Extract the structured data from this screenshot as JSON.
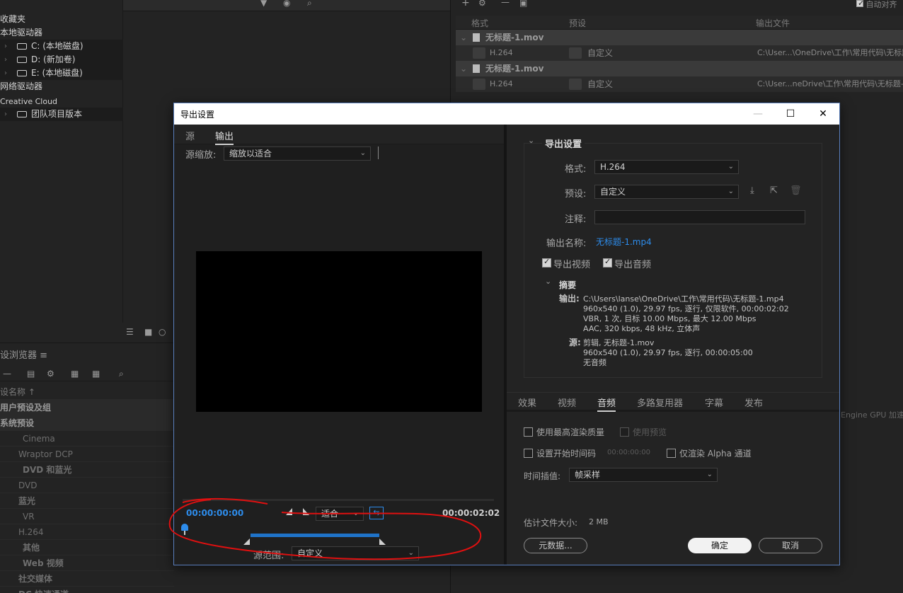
{
  "background_app": {
    "tree": {
      "favorites": "收藏夹",
      "local_drives": "本地驱动器",
      "drive_c": "C: (本地磁盘)",
      "drive_d": "D: (新加卷)",
      "drive_e": "E: (本地磁盘)",
      "network_drives": "网络驱动器",
      "creative_cloud": "Creative Cloud",
      "team_project": "团队项目版本"
    },
    "preset_browser": {
      "title": "设浏览器",
      "column_preset_name": "设名称",
      "user_presets": "用户预设及组",
      "system_presets": "系统预设",
      "items": [
        "Cinema",
        "Wraptor DCP",
        "DVD 和蓝光",
        "DVD",
        "蓝光",
        "VR",
        "H.264",
        "其他",
        "Web 视频",
        "社交媒体",
        "DC 快速通道"
      ]
    },
    "queue": {
      "auto_label": "自动对齐",
      "col_format": "格式",
      "col_preset": "预设",
      "col_output": "输出文件",
      "sources": [
        {
          "name": "无标题-1.mov",
          "format": "H.264",
          "preset": "自定义",
          "output": "C:\\User...\\OneDrive\\工作\\常用代码\\无标题-1.mp4"
        },
        {
          "name": "无标题-1.mov",
          "format": "H.264",
          "preset": "自定义",
          "output": "C:\\User...neDrive\\工作\\常用代码\\无标题-1.mp4"
        }
      ],
      "gpu_hint": "Engine GPU 加速"
    }
  },
  "dialog": {
    "title": "导出设置",
    "tabs": {
      "source": "源",
      "output": "输出"
    },
    "source_scale_label": "源缩放:",
    "source_scale_value": "缩放以适合",
    "timecode_in": "00:00:00:00",
    "timecode_out": "00:00:02:02",
    "fit_value": "适合",
    "source_range_label": "源范围:",
    "source_range_value": "自定义",
    "export_settings": {
      "section_title": "导出设置",
      "format_label": "格式:",
      "format_value": "H.264",
      "preset_label": "预设:",
      "preset_value": "自定义",
      "comment_label": "注释:",
      "comment_value": "",
      "output_name_label": "输出名称:",
      "output_name_value": "无标题-1.mp4",
      "export_video_label": "导出视频",
      "export_video_checked": true,
      "export_audio_label": "导出音频",
      "export_audio_checked": true,
      "summary_title": "摘要",
      "output_label": "输出:",
      "output_lines": [
        "C:\\Users\\lanse\\OneDrive\\工作\\常用代码\\无标题-1.mp4",
        "960x540 (1.0), 29.97 fps, 逐行, 仅限软件, 00:00:02:02",
        "VBR, 1 次, 目标 10.00 Mbps, 最大 12.00 Mbps",
        "AAC, 320 kbps, 48 kHz, 立体声"
      ],
      "source_label": "源:",
      "source_lines": [
        "剪辑, 无标题-1.mov",
        "960x540 (1.0), 29.97 fps, 逐行, 00:00:05:00",
        "无音频"
      ]
    },
    "bottom_tabs": [
      "效果",
      "视频",
      "音频",
      "多路复用器",
      "字幕",
      "发布"
    ],
    "active_bottom_tab": "音频",
    "options": {
      "max_render_quality": "使用最高渲染质量",
      "use_previews": "使用预览",
      "set_start_timecode": "设置开始时间码",
      "start_timecode_value": "00:00:00:00",
      "render_alpha_only": "仅渲染 Alpha 通道",
      "time_interp_label": "时间插值:",
      "time_interp_value": "帧采样"
    },
    "estimated_size_label": "估计文件大小:",
    "estimated_size_value": "2 MB",
    "buttons": {
      "metadata": "元数据...",
      "ok": "确定",
      "cancel": "取消"
    },
    "colors": {
      "timecode": "#2d8ceb",
      "link": "#2d8ceb",
      "annotation": "#e01010",
      "range_bar": "#1f73c9"
    }
  }
}
